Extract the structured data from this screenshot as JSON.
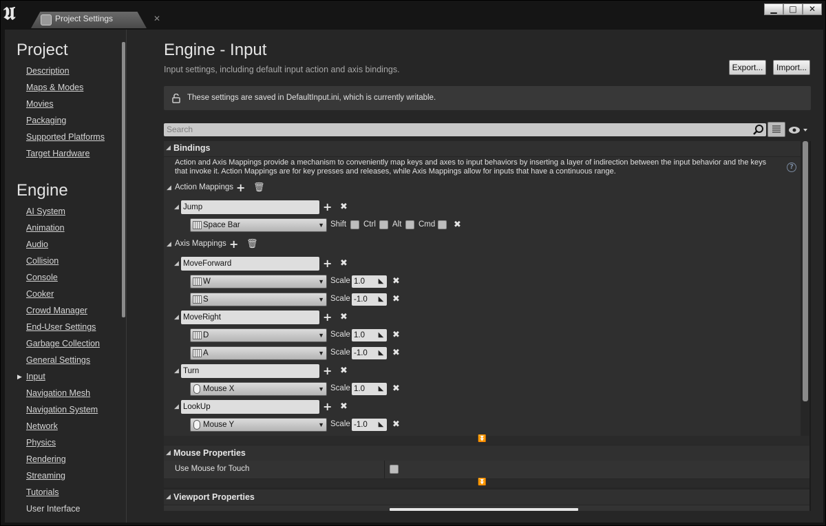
{
  "window": {
    "tab_title": "Project Settings",
    "close_glyph": "✕",
    "buttons": {
      "minimize": "▁",
      "maximize": "□",
      "close": "✕"
    }
  },
  "sidebar": {
    "project_title": "Project",
    "project_items": [
      "Description",
      "Maps & Modes",
      "Movies",
      "Packaging",
      "Supported Platforms",
      "Target Hardware"
    ],
    "engine_title": "Engine",
    "engine_items": [
      "AI System",
      "Animation",
      "Audio",
      "Collision",
      "Console",
      "Cooker",
      "Crowd Manager",
      "End-User Settings",
      "Garbage Collection",
      "General Settings",
      "Input",
      "Navigation Mesh",
      "Navigation System",
      "Network",
      "Physics",
      "Rendering",
      "Streaming",
      "Tutorials",
      "User Interface"
    ],
    "selected": "Input"
  },
  "header": {
    "title": "Engine - Input",
    "subtitle": "Input settings, including default input action and axis bindings.",
    "export_label": "Export...",
    "import_label": "Import..."
  },
  "notice": {
    "text": "These settings are saved in DefaultInput.ini, which is currently writable.",
    "icon": "unlock-icon"
  },
  "search": {
    "placeholder": "Search"
  },
  "bindings": {
    "title": "Bindings",
    "description": "Action and Axis Mappings provide a mechanism to conveniently map keys and axes to input behaviors by inserting a layer of indirection between the input behavior and the keys that invoke it. Action Mappings are for key presses and releases, while Axis Mappings allow for inputs that have a continuous range.",
    "action_label": "Action Mappings",
    "axis_label": "Axis Mappings",
    "actions": [
      {
        "name": "Jump",
        "key": "Space Bar",
        "mods": [
          "Shift",
          "Ctrl",
          "Alt",
          "Cmd"
        ]
      }
    ],
    "axes": [
      {
        "name": "MoveForward",
        "keys": [
          {
            "key": "W",
            "scale": "1.0"
          },
          {
            "key": "S",
            "scale": "-1.0"
          }
        ]
      },
      {
        "name": "MoveRight",
        "keys": [
          {
            "key": "D",
            "scale": "1.0"
          },
          {
            "key": "A",
            "scale": "-1.0"
          }
        ]
      },
      {
        "name": "Turn",
        "keys": [
          {
            "key": "Mouse X",
            "scale": "1.0"
          }
        ]
      },
      {
        "name": "LookUp",
        "keys": [
          {
            "key": "Mouse Y",
            "scale": "-1.0"
          }
        ]
      }
    ],
    "scale_label": "Scale"
  },
  "mouse_properties": {
    "title": "Mouse Properties",
    "use_mouse_for_touch_label": "Use Mouse for Touch",
    "use_mouse_for_touch": false
  },
  "viewport_properties": {
    "title": "Viewport Properties"
  }
}
